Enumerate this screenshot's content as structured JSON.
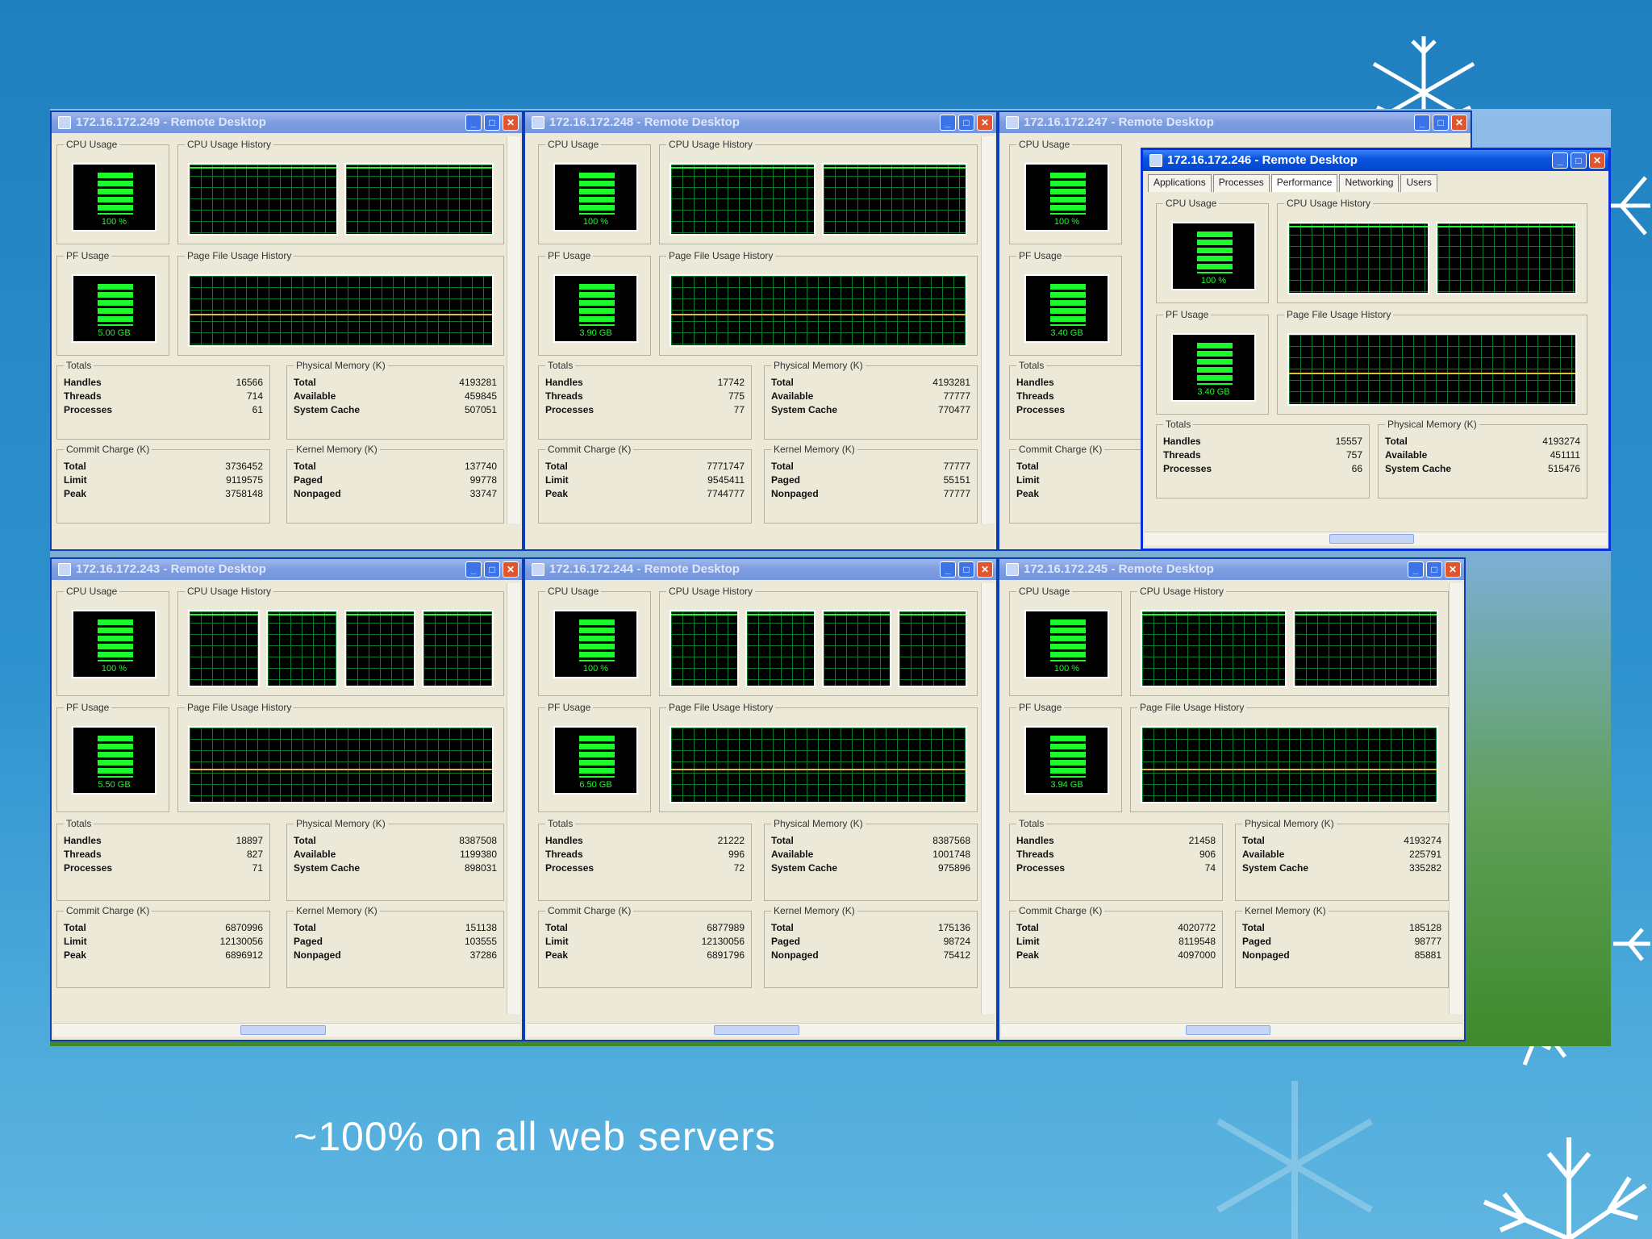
{
  "slide": {
    "caption": "~100% on all web servers"
  },
  "colors": {
    "window_border": "#0831d9",
    "meter_green": "#1cfa2c",
    "page_file_line": "#e0c030",
    "grid": "#0b7a2a"
  },
  "icons": [
    "snowflake-icon",
    "window-icon",
    "minimize-icon",
    "maximize-icon",
    "close-icon"
  ],
  "windows": [
    {
      "title": "172.16.172.249 - Remote Desktop",
      "group_cpu": "CPU Usage",
      "group_cpu_hist": "CPU Usage History",
      "group_pf": "PF Usage",
      "group_pf_hist": "Page File Usage History",
      "cpu_value": "100 %",
      "pf_value": "5.00 GB",
      "totals_title": "Totals",
      "totals": [
        [
          "Handles",
          "16566"
        ],
        [
          "Threads",
          "714"
        ],
        [
          "Processes",
          "61"
        ]
      ],
      "phys_title": "Physical Memory (K)",
      "phys": [
        [
          "Total",
          "4193281"
        ],
        [
          "Available",
          "459845"
        ],
        [
          "System Cache",
          "507051"
        ]
      ],
      "commit_title": "Commit Charge (K)",
      "commit": [
        [
          "Total",
          "3736452"
        ],
        [
          "Limit",
          "9119575"
        ],
        [
          "Peak",
          "3758148"
        ]
      ],
      "kernel_title": "Kernel Memory (K)",
      "kernel": [
        [
          "Total",
          "137740"
        ],
        [
          "Paged",
          "99778"
        ],
        [
          "Nonpaged",
          "33747"
        ]
      ]
    },
    {
      "title": "172.16.172.248 - Remote Desktop",
      "group_cpu": "CPU Usage",
      "group_cpu_hist": "CPU Usage History",
      "group_pf": "PF Usage",
      "group_pf_hist": "Page File Usage History",
      "cpu_value": "100 %",
      "pf_value": "3.90 GB",
      "totals_title": "Totals",
      "totals": [
        [
          "Handles",
          "17742"
        ],
        [
          "Threads",
          "775"
        ],
        [
          "Processes",
          "77"
        ]
      ],
      "phys_title": "Physical Memory (K)",
      "phys": [
        [
          "Total",
          "4193281"
        ],
        [
          "Available",
          "77777"
        ],
        [
          "System Cache",
          "770477"
        ]
      ],
      "commit_title": "Commit Charge (K)",
      "commit": [
        [
          "Total",
          "7771747"
        ],
        [
          "Limit",
          "9545411"
        ],
        [
          "Peak",
          "7744777"
        ]
      ],
      "kernel_title": "Kernel Memory (K)",
      "kernel": [
        [
          "Total",
          "77777"
        ],
        [
          "Paged",
          "55151"
        ],
        [
          "Nonpaged",
          "77777"
        ]
      ]
    },
    {
      "title": "172.16.172.247 - Remote Desktop",
      "group_cpu": "CPU Usage",
      "group_pf": "PF Usage",
      "cpu_value": "100 %",
      "pf_value": "3.40 GB",
      "totals_title": "Totals",
      "totals": [
        [
          "Handles",
          ""
        ],
        [
          "Threads",
          ""
        ],
        [
          "Processes",
          ""
        ]
      ],
      "commit_title": "Commit Charge (K)",
      "commit": [
        [
          "Total",
          ""
        ],
        [
          "Limit",
          ""
        ],
        [
          "Peak",
          ""
        ]
      ]
    },
    {
      "title": "172.16.172.246 - Remote Desktop",
      "tabs": [
        "Applications",
        "Processes",
        "Performance",
        "Networking",
        "Users"
      ],
      "group_cpu": "CPU Usage",
      "group_cpu_hist": "CPU Usage History",
      "group_pf": "PF Usage",
      "group_pf_hist": "Page File Usage History",
      "cpu_value": "100 %",
      "pf_value": "3.40 GB",
      "totals_title": "Totals",
      "totals": [
        [
          "Handles",
          "15557"
        ],
        [
          "Threads",
          "757"
        ],
        [
          "Processes",
          "66"
        ]
      ],
      "phys_title": "Physical Memory (K)",
      "phys": [
        [
          "Total",
          "4193274"
        ],
        [
          "Available",
          "451111"
        ],
        [
          "System Cache",
          "515476"
        ]
      ]
    },
    {
      "title": "172.16.172.243 - Remote Desktop",
      "group_cpu": "CPU Usage",
      "group_cpu_hist": "CPU Usage History",
      "group_pf": "PF Usage",
      "group_pf_hist": "Page File Usage History",
      "cpu_value": "100 %",
      "pf_value": "5.50 GB",
      "totals_title": "Totals",
      "totals": [
        [
          "Handles",
          "18897"
        ],
        [
          "Threads",
          "827"
        ],
        [
          "Processes",
          "71"
        ]
      ],
      "phys_title": "Physical Memory (K)",
      "phys": [
        [
          "Total",
          "8387508"
        ],
        [
          "Available",
          "1199380"
        ],
        [
          "System Cache",
          "898031"
        ]
      ],
      "commit_title": "Commit Charge (K)",
      "commit": [
        [
          "Total",
          "6870996"
        ],
        [
          "Limit",
          "12130056"
        ],
        [
          "Peak",
          "6896912"
        ]
      ],
      "kernel_title": "Kernel Memory (K)",
      "kernel": [
        [
          "Total",
          "151138"
        ],
        [
          "Paged",
          "103555"
        ],
        [
          "Nonpaged",
          "37286"
        ]
      ]
    },
    {
      "title": "172.16.172.244 - Remote Desktop",
      "group_cpu": "CPU Usage",
      "group_cpu_hist": "CPU Usage History",
      "group_pf": "PF Usage",
      "group_pf_hist": "Page File Usage History",
      "cpu_value": "100 %",
      "pf_value": "6.50 GB",
      "totals_title": "Totals",
      "totals": [
        [
          "Handles",
          "21222"
        ],
        [
          "Threads",
          "996"
        ],
        [
          "Processes",
          "72"
        ]
      ],
      "phys_title": "Physical Memory (K)",
      "phys": [
        [
          "Total",
          "8387568"
        ],
        [
          "Available",
          "1001748"
        ],
        [
          "System Cache",
          "975896"
        ]
      ],
      "commit_title": "Commit Charge (K)",
      "commit": [
        [
          "Total",
          "6877989"
        ],
        [
          "Limit",
          "12130056"
        ],
        [
          "Peak",
          "6891796"
        ]
      ],
      "kernel_title": "Kernel Memory (K)",
      "kernel": [
        [
          "Total",
          "175136"
        ],
        [
          "Paged",
          "98724"
        ],
        [
          "Nonpaged",
          "75412"
        ]
      ]
    },
    {
      "title": "172.16.172.245 - Remote Desktop",
      "group_cpu": "CPU Usage",
      "group_cpu_hist": "CPU Usage History",
      "group_pf": "PF Usage",
      "group_pf_hist": "Page File Usage History",
      "cpu_value": "100 %",
      "pf_value": "3.94 GB",
      "totals_title": "Totals",
      "totals": [
        [
          "Handles",
          "21458"
        ],
        [
          "Threads",
          "906"
        ],
        [
          "Processes",
          "74"
        ]
      ],
      "phys_title": "Physical Memory (K)",
      "phys": [
        [
          "Total",
          "4193274"
        ],
        [
          "Available",
          "225791"
        ],
        [
          "System Cache",
          "335282"
        ]
      ],
      "commit_title": "Commit Charge (K)",
      "commit": [
        [
          "Total",
          "4020772"
        ],
        [
          "Limit",
          "8119548"
        ],
        [
          "Peak",
          "4097000"
        ]
      ],
      "kernel_title": "Kernel Memory (K)",
      "kernel": [
        [
          "Total",
          "185128"
        ],
        [
          "Paged",
          "98777"
        ],
        [
          "Nonpaged",
          "85881"
        ]
      ]
    }
  ]
}
